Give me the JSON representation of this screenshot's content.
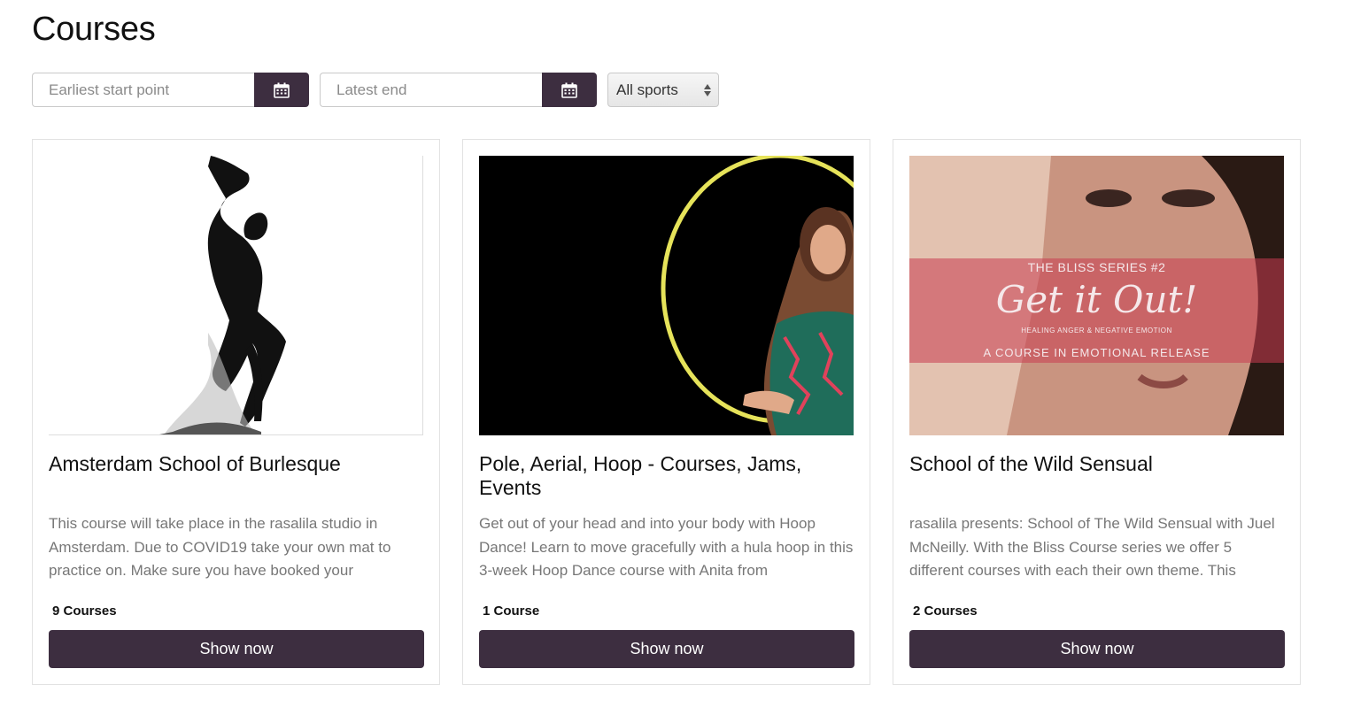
{
  "page": {
    "title": "Courses"
  },
  "filters": {
    "start_placeholder": "Earliest start point",
    "end_placeholder": "Latest end",
    "sport_select": {
      "selected": "All sports"
    },
    "calendar_icon": "calendar-icon"
  },
  "colors": {
    "accent": "#3d2e40",
    "muted_text": "#777777"
  },
  "cards": [
    {
      "title": "Amsterdam School of Burlesque",
      "description": "This course will take place in the rasalila studio in Amsterdam. Due to COVID19 take your own mat to practice on. Make sure you have booked your",
      "count": "9 Courses",
      "button": "Show now"
    },
    {
      "title": "Pole, Aerial, Hoop - Courses, Jams, Events",
      "description": "Get out of your head and into your body with Hoop Dance! Learn to move gracefully with a hula hoop in this 3-week Hoop Dance course with Anita from",
      "count": "1 Course",
      "button": "Show now"
    },
    {
      "title": "School of the Wild Sensual",
      "description": "rasalila presents: School of The Wild Sensual with Juel McNeilly. With the Bliss Course series we offer 5 different courses with each their own theme. This",
      "count": "2 Courses",
      "button": "Show now",
      "image_text": {
        "series": "THE BLISS SERIES #2",
        "headline": "Get it Out!",
        "subtitle": "HEALING ANGER & NEGATIVE EMOTION",
        "tagline": "A COURSE IN EMOTIONAL RELEASE"
      }
    }
  ]
}
